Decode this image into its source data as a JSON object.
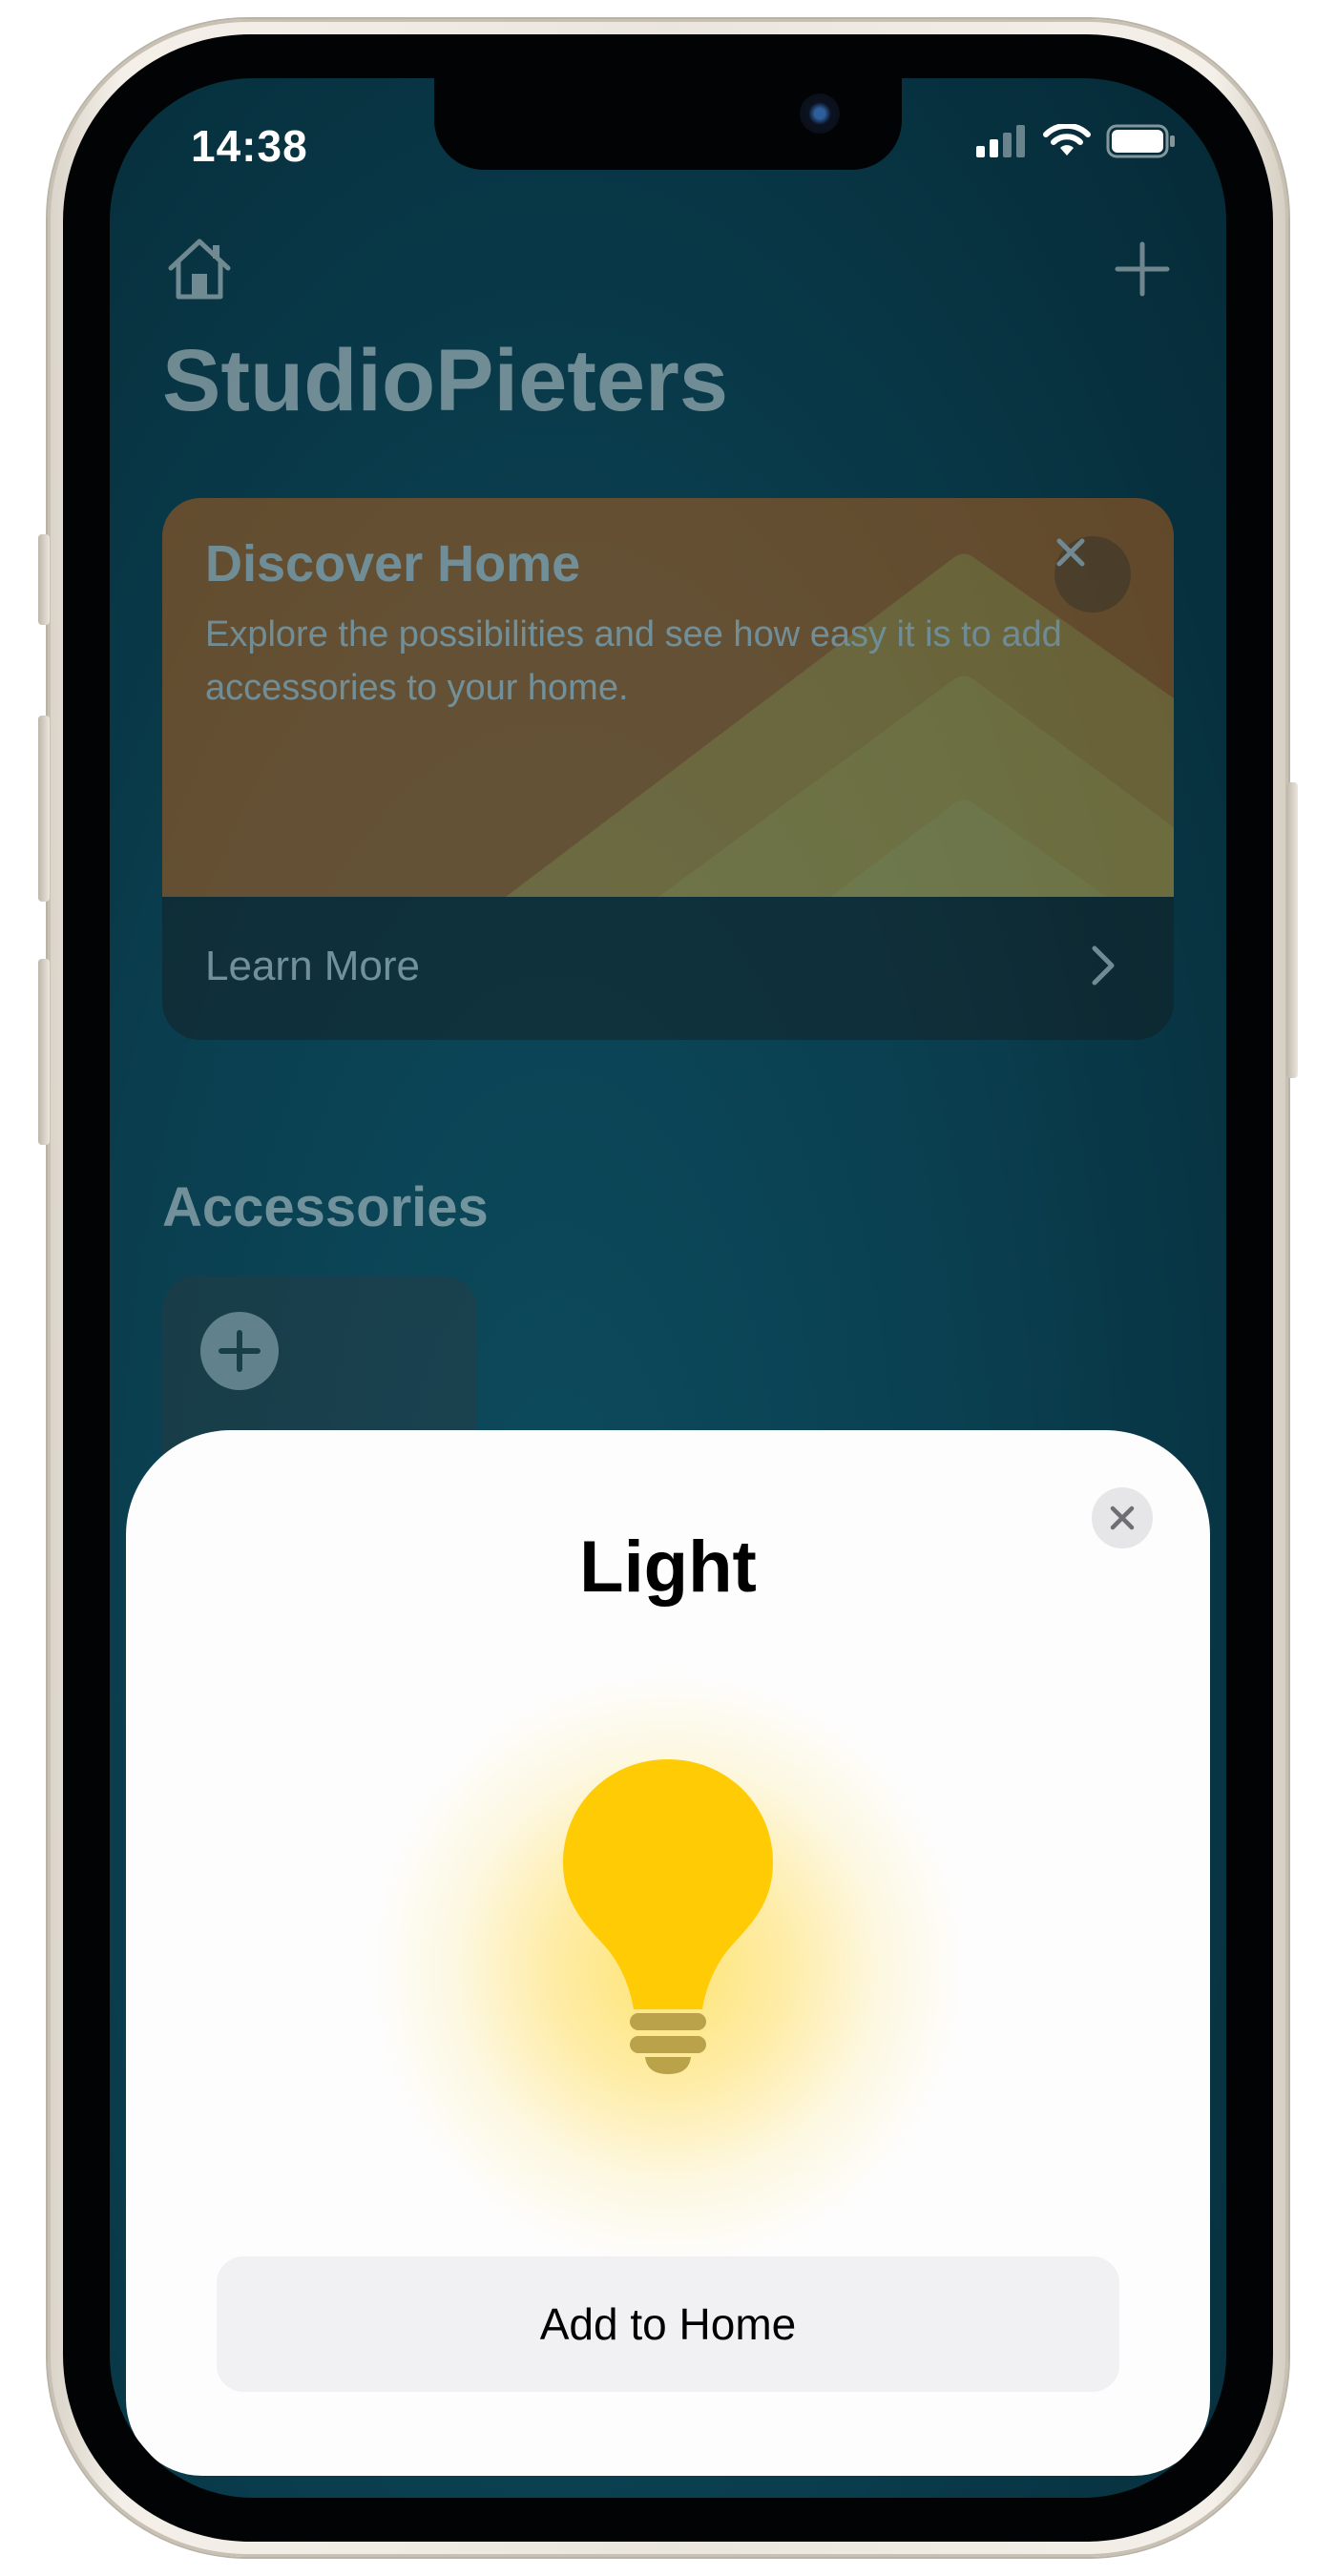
{
  "status_bar": {
    "time": "14:38",
    "icons": [
      "cellular-signal-icon",
      "wifi-icon",
      "battery-icon"
    ]
  },
  "home": {
    "title": "StudioPieters",
    "icons": [
      "home-icon",
      "plus-icon"
    ],
    "discover_card": {
      "title": "Discover Home",
      "subtitle": "Explore the possibilities and see how easy it is to add accessories to your home.",
      "link_label": "Learn More",
      "color": "#e06a10"
    },
    "accessories": {
      "heading": "Accessories"
    }
  },
  "sheet": {
    "title": "Light",
    "illustration": "lightbulb-icon",
    "bulb_color": "#ffcb05",
    "primary_button": "Add to Home"
  }
}
